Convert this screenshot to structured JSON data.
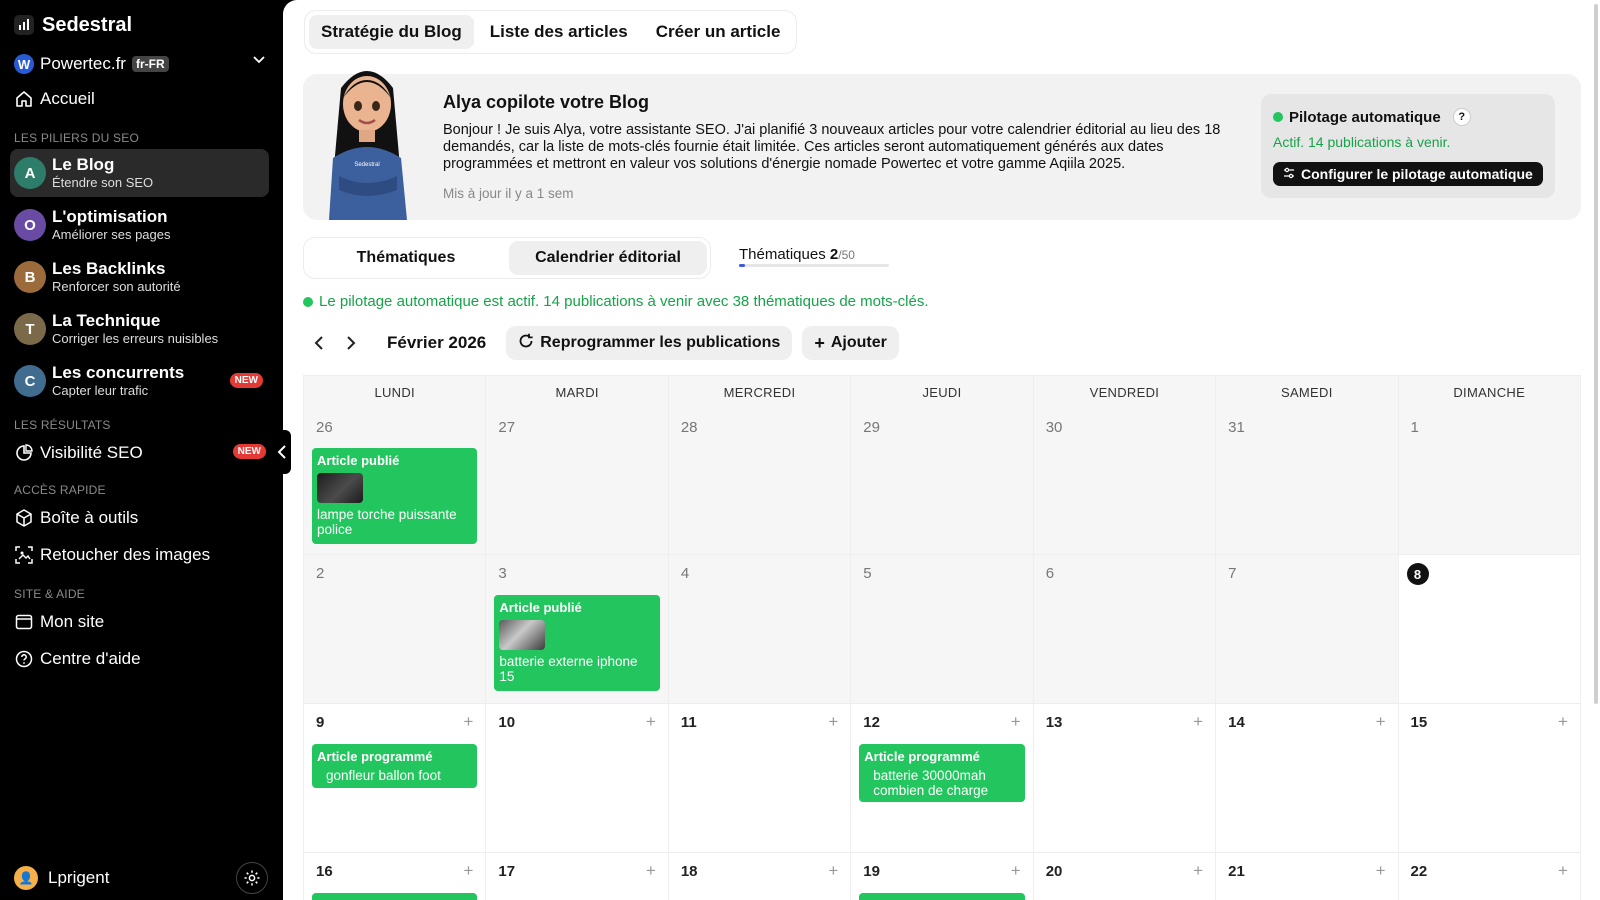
{
  "sidebar": {
    "brand": "Sedestral",
    "site_name": "Powertec.fr",
    "site_lang": "fr-FR",
    "home_label": "Accueil",
    "sections": {
      "pillars": "LES PILIERS DU SEO",
      "results": "LES RÉSULTATS",
      "quick": "ACCÈS RAPIDE",
      "site_help": "SITE & AIDE"
    },
    "pillars": [
      {
        "title": "Le Blog",
        "subtitle": "Étendre son SEO",
        "color": "#2e7d6a"
      },
      {
        "title": "L'optimisation",
        "subtitle": "Améliorer ses pages",
        "color": "#6a4ba3"
      },
      {
        "title": "Les Backlinks",
        "subtitle": "Renforcer son autorité",
        "color": "#9b6b3c"
      },
      {
        "title": "La Technique",
        "subtitle": "Corriger les erreurs nuisibles",
        "color": "#7a6a4a"
      },
      {
        "title": "Les concurrents",
        "subtitle": "Capter leur trafic",
        "badge": "NEW",
        "color": "#3f6c8f"
      }
    ],
    "visibility_label": "Visibilité SEO",
    "visibility_badge": "NEW",
    "toolbox_label": "Boîte à outils",
    "retouch_label": "Retoucher des images",
    "mysite_label": "Mon site",
    "help_label": "Centre d'aide",
    "user_name": "Lprigent"
  },
  "top_tabs": [
    "Stratégie du Blog",
    "Liste des articles",
    "Créer un article"
  ],
  "hero": {
    "title": "Alya copilote votre Blog",
    "text": "Bonjour ! Je suis Alya, votre assistante SEO. J'ai planifié 3 nouveaux articles pour votre calendrier éditorial au lieu des 18 demandés, car la liste de mots-clés fournie était limitée. Ces articles seront automatiquement générés aux dates programmées et mettront en valeur vos solutions d'énergie nomade Powertec et votre gamme Aqiila 2025.",
    "updated": "Mis à jour il y a 1 sem",
    "avatar_label": "Sedestral",
    "auto": {
      "title": "Pilotage automatique",
      "help": "?",
      "subtitle": "Actif. 14 publications à venir.",
      "button": "Configurer le pilotage automatique"
    }
  },
  "sub_tabs": [
    "Thématiques",
    "Calendrier éditorial"
  ],
  "themes": {
    "label": "Thématiques",
    "count": "2",
    "total": "/50",
    "fraction": 0.04
  },
  "status_line": "Le pilotage automatique est actif. 14 publications à venir avec 38 thématiques de mots-clés.",
  "calendar": {
    "month": "Février 2026",
    "reschedule_label": "Reprogrammer les publications",
    "add_label": "Ajouter",
    "weekdays": [
      "LUNDI",
      "MARDI",
      "MERCREDI",
      "JEUDI",
      "VENDREDI",
      "SAMEDI",
      "DIMANCHE"
    ],
    "weeks": [
      [
        "26",
        "27",
        "28",
        "29",
        "30",
        "31",
        "1"
      ],
      [
        "2",
        "3",
        "4",
        "5",
        "6",
        "7",
        "8"
      ],
      [
        "9",
        "10",
        "11",
        "12",
        "13",
        "14",
        "15"
      ],
      [
        "16",
        "17",
        "18",
        "19",
        "20",
        "21",
        "22"
      ]
    ],
    "events": {
      "e1": {
        "status": "Article publié",
        "title": "lampe torche puissante police"
      },
      "e2": {
        "status": "Article publié",
        "title": "batterie externe iphone 15"
      },
      "e3": {
        "status": "Article programmé",
        "title": "gonfleur ballon foot"
      },
      "e4": {
        "status": "Article programmé",
        "title": "batterie 30000mah combien de charge"
      }
    }
  },
  "colors": {
    "accent_green": "#22c55e",
    "text_green": "#16a34a",
    "badge_red": "#e53935"
  },
  "icons": {
    "home": "home-icon",
    "visibility": "pie-chart-icon",
    "toolbox": "box-icon",
    "retouch": "image-edit-icon",
    "mysite": "browser-icon",
    "help": "help-circle-icon",
    "settings": "gear-icon",
    "reschedule": "refresh-icon",
    "add": "plus-icon"
  }
}
